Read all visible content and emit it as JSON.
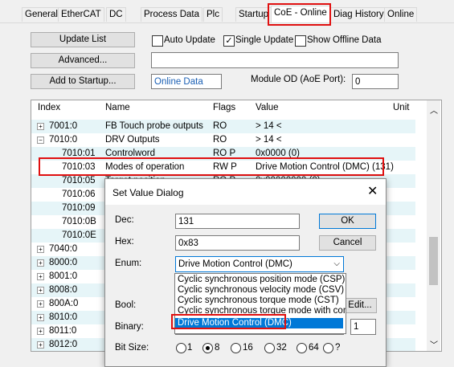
{
  "tabs": [
    "General",
    "EtherCAT",
    "DC",
    "Process Data",
    "Plc",
    "Startup",
    "CoE - Online",
    "Diag History",
    "Online"
  ],
  "toolbar": {
    "update_list": "Update List",
    "advanced": "Advanced...",
    "add_to_startup": "Add to Startup...",
    "auto_update": "Auto Update",
    "single_update": "Single Update",
    "show_offline": "Show Offline Data",
    "online_data": "Online Data",
    "module_od_label": "Module OD (AoE Port):",
    "module_od_value": "0"
  },
  "table": {
    "headers": {
      "index": "Index",
      "name": "Name",
      "flags": "Flags",
      "value": "Value",
      "unit": "Unit"
    },
    "rows": [
      {
        "index": "7001:0",
        "name": "FB Touch probe  outputs",
        "flags": "RO",
        "value": "> 14 <"
      },
      {
        "index": "7010:0",
        "name": "DRV Outputs",
        "flags": "RO",
        "value": "> 14 <"
      },
      {
        "index": "7010:01",
        "name": "Controlword",
        "flags": "RO P",
        "value": "0x0000 (0)"
      },
      {
        "index": "7010:03",
        "name": "Modes of operation",
        "flags": "RW P",
        "value": "Drive Motion Control (DMC) (131)"
      },
      {
        "index": "7010:05",
        "name": "Target position",
        "flags": "RO P",
        "value": "0x00000000 (0)"
      },
      {
        "index": "7010:06",
        "name": "",
        "flags": "",
        "value": ""
      },
      {
        "index": "7010:09",
        "name": "",
        "flags": "",
        "value": ""
      },
      {
        "index": "7010:0B",
        "name": "",
        "flags": "",
        "value": ""
      },
      {
        "index": "7010:0E",
        "name": "",
        "flags": "",
        "value": ""
      },
      {
        "index": "7040:0",
        "name": "",
        "flags": "",
        "value": ""
      },
      {
        "index": "8000:0",
        "name": "",
        "flags": "",
        "value": ""
      },
      {
        "index": "8001:0",
        "name": "",
        "flags": "",
        "value": ""
      },
      {
        "index": "8008:0",
        "name": "",
        "flags": "",
        "value": ""
      },
      {
        "index": "800A:0",
        "name": "",
        "flags": "",
        "value": ""
      },
      {
        "index": "8010:0",
        "name": "",
        "flags": "",
        "value": ""
      },
      {
        "index": "8011:0",
        "name": "",
        "flags": "",
        "value": ""
      },
      {
        "index": "8012:0",
        "name": "",
        "flags": "",
        "value": ""
      }
    ]
  },
  "dialog": {
    "title": "Set Value Dialog",
    "dec_label": "Dec:",
    "dec_value": "131",
    "hex_label": "Hex:",
    "hex_value": "0x83",
    "enum_label": "Enum:",
    "enum_value": "Drive Motion Control (DMC)",
    "bool_label": "Bool:",
    "binary_label": "Binary:",
    "binary_value": "1",
    "bitsize_label": "Bit Size:",
    "ok": "OK",
    "cancel": "Cancel",
    "edit": "Edit...",
    "enum_options": [
      "Cyclic synchronous position mode (CSP)",
      "Cyclic synchronous velocity mode (CSV)",
      "Cyclic synchronous torque mode (CST)",
      "Cyclic synchronous torque mode with comm",
      "Drive Motion Control (DMC)"
    ],
    "bit_sizes": [
      "1",
      "8",
      "16",
      "32",
      "64",
      "?"
    ]
  }
}
